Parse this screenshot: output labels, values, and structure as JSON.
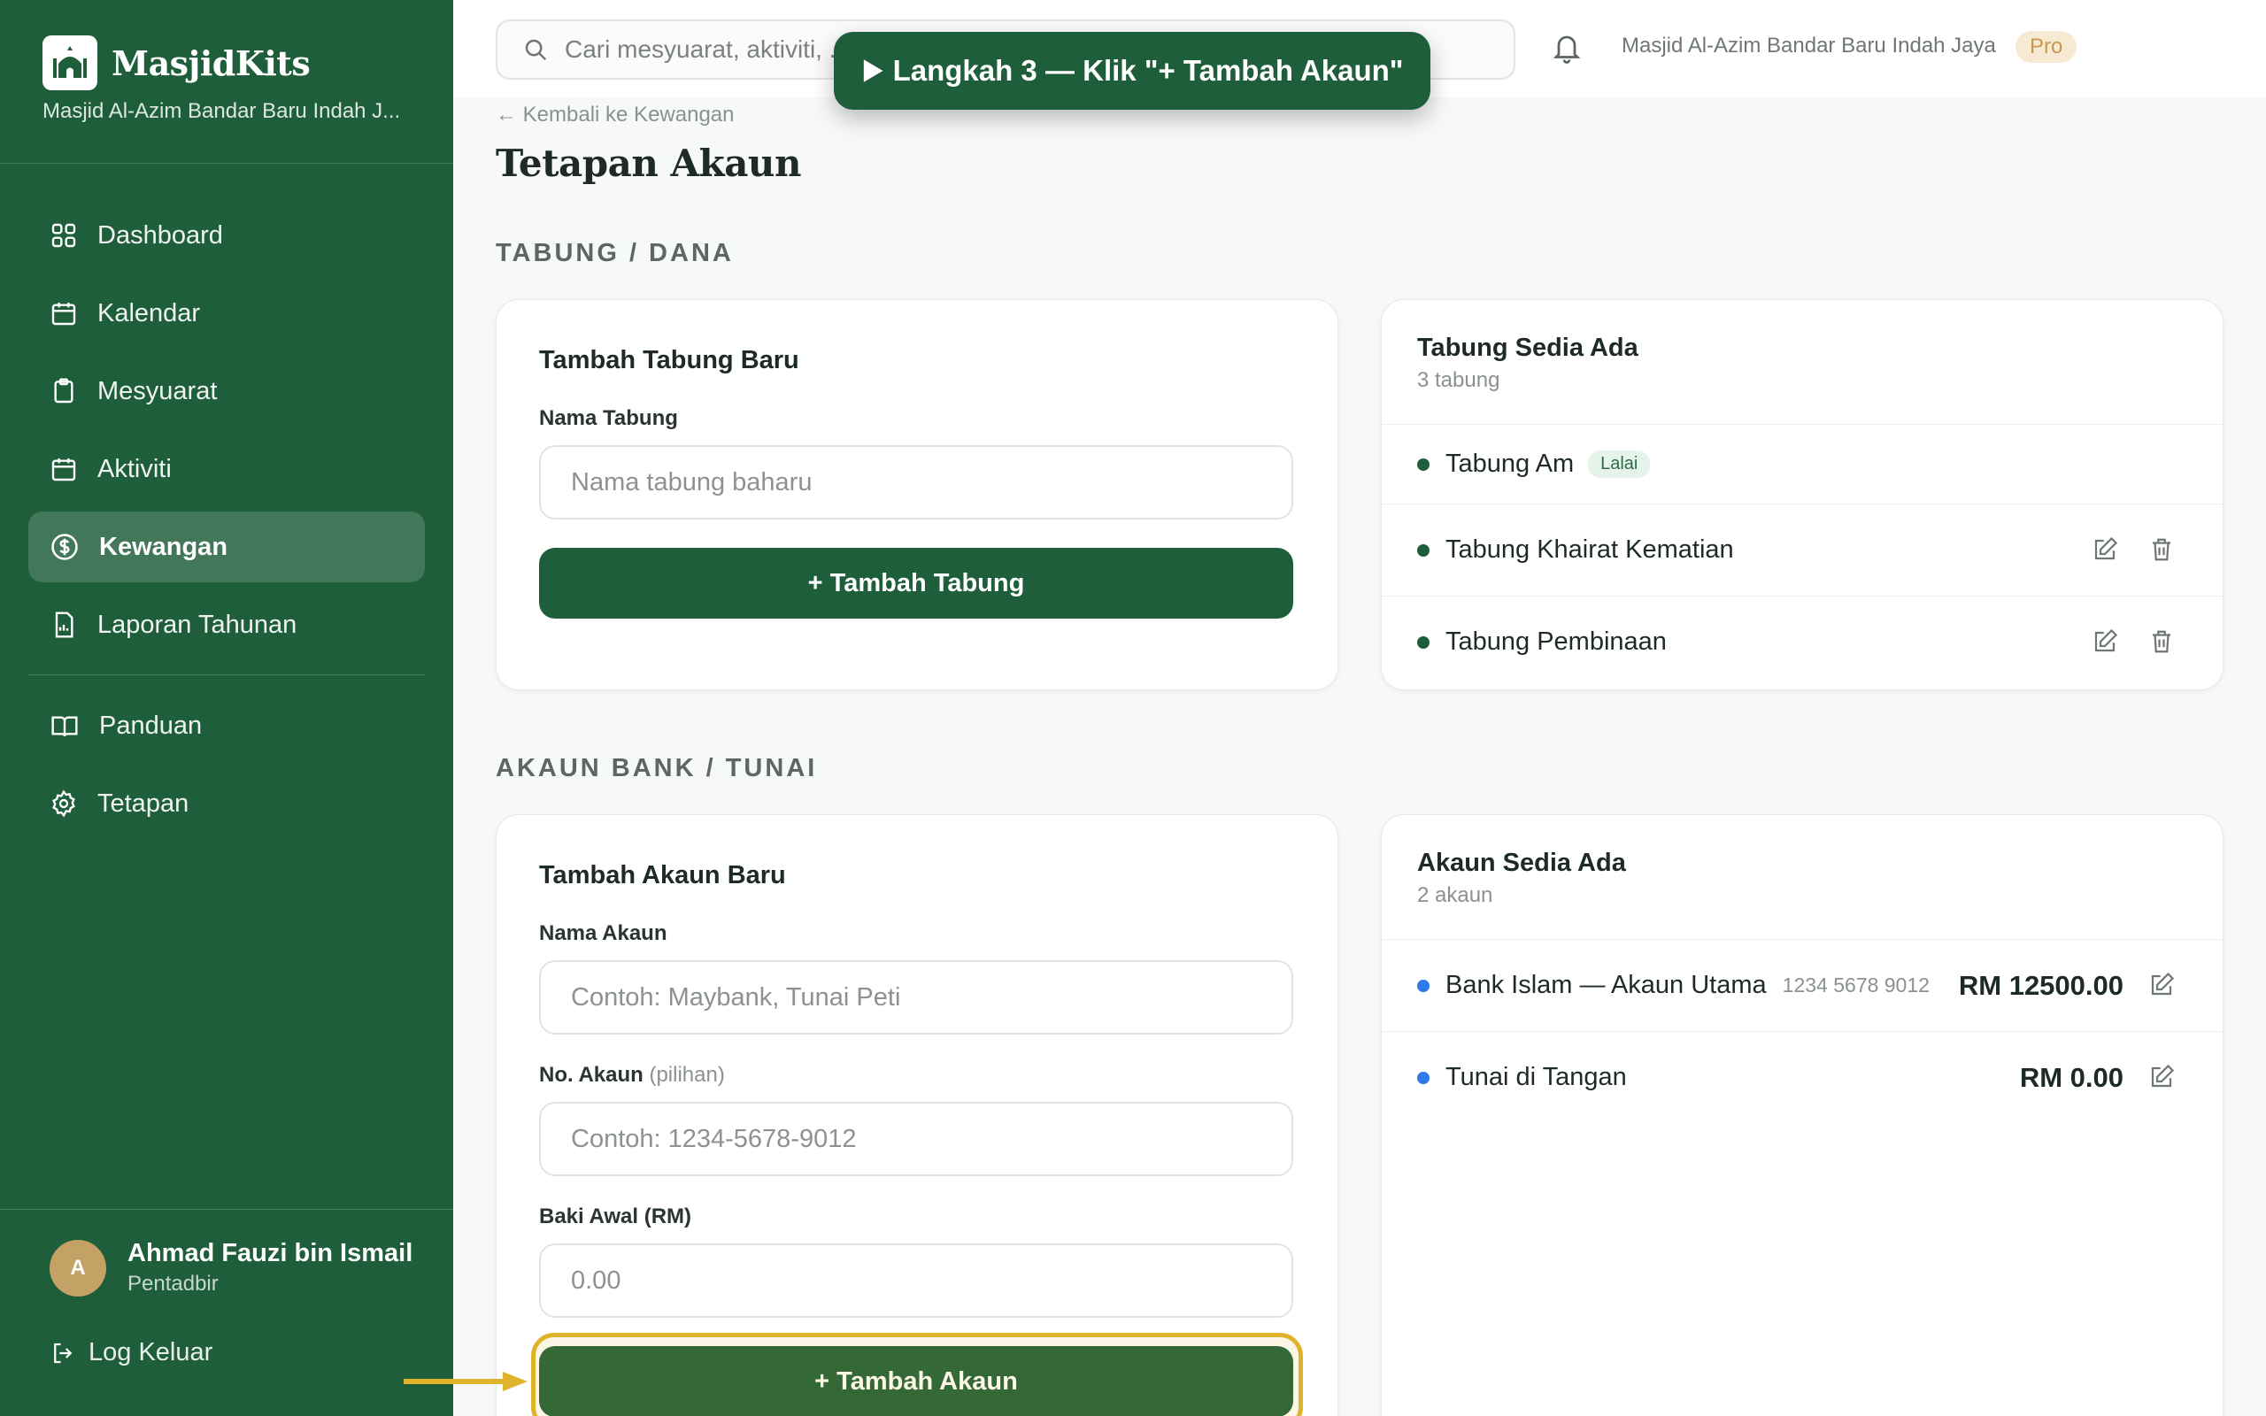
{
  "app": {
    "name": "MasjidKits",
    "org_short": "Masjid Al-Azim Bandar Baru Indah J..."
  },
  "sidebar": {
    "items": [
      {
        "label": "Dashboard",
        "icon": "grid-icon"
      },
      {
        "label": "Kalendar",
        "icon": "calendar-icon"
      },
      {
        "label": "Mesyuarat",
        "icon": "clipboard-icon"
      },
      {
        "label": "Aktiviti",
        "icon": "calendar-icon"
      },
      {
        "label": "Kewangan",
        "icon": "dollar-circle-icon",
        "active": true
      },
      {
        "label": "Laporan Tahunan",
        "icon": "report-icon"
      },
      {
        "label": "Panduan",
        "icon": "book-icon"
      },
      {
        "label": "Tetapan",
        "icon": "gear-icon"
      }
    ],
    "user": {
      "initial": "A",
      "name": "Ahmad Fauzi bin Ismail",
      "role": "Pentadbir"
    },
    "logout_label": "Log Keluar"
  },
  "topbar": {
    "search_placeholder": "Cari mesyuarat, aktiviti, ...",
    "org_name": "Masjid Al-Azim Bandar Baru Indah Jaya",
    "plan_badge": "Pro"
  },
  "banner": {
    "text": "Langkah 3 — Klik \"+ Tambah Akaun\""
  },
  "page": {
    "back_link": "← Kembali ke Kewangan",
    "title": "Tetapan Akaun"
  },
  "tabung": {
    "section_title": "TABUNG / DANA",
    "form": {
      "title": "Tambah Tabung Baru",
      "name_label": "Nama Tabung",
      "name_placeholder": "Nama tabung baharu",
      "submit_label": "+ Tambah Tabung"
    },
    "list": {
      "title": "Tabung Sedia Ada",
      "count": "3 tabung",
      "items": [
        {
          "name": "Tabung Am",
          "tag": "Lalai"
        },
        {
          "name": "Tabung Khairat Kematian"
        },
        {
          "name": "Tabung Pembinaan"
        }
      ]
    }
  },
  "akaun": {
    "section_title": "AKAUN BANK / TUNAI",
    "form": {
      "title": "Tambah Akaun Baru",
      "name_label": "Nama Akaun",
      "name_placeholder": "Contoh: Maybank, Tunai Peti",
      "number_label": "No. Akaun",
      "number_hint": "(pilihan)",
      "number_placeholder": "Contoh: 1234-5678-9012",
      "balance_label": "Baki Awal (RM)",
      "balance_placeholder": "0.00",
      "submit_label": "+ Tambah Akaun"
    },
    "list": {
      "title": "Akaun Sedia Ada",
      "count": "2 akaun",
      "items": [
        {
          "name": "Bank Islam — Akaun Utama",
          "number": "1234 5678 9012",
          "balance": "RM 12500.00"
        },
        {
          "name": "Tunai di Tangan",
          "number": "",
          "balance": "RM 0.00"
        }
      ]
    }
  },
  "colors": {
    "primary": "#1e5e3a",
    "highlight": "#e0b32c",
    "fund_dot": "#1e5e3a",
    "account_dot": "#2f7be6"
  }
}
